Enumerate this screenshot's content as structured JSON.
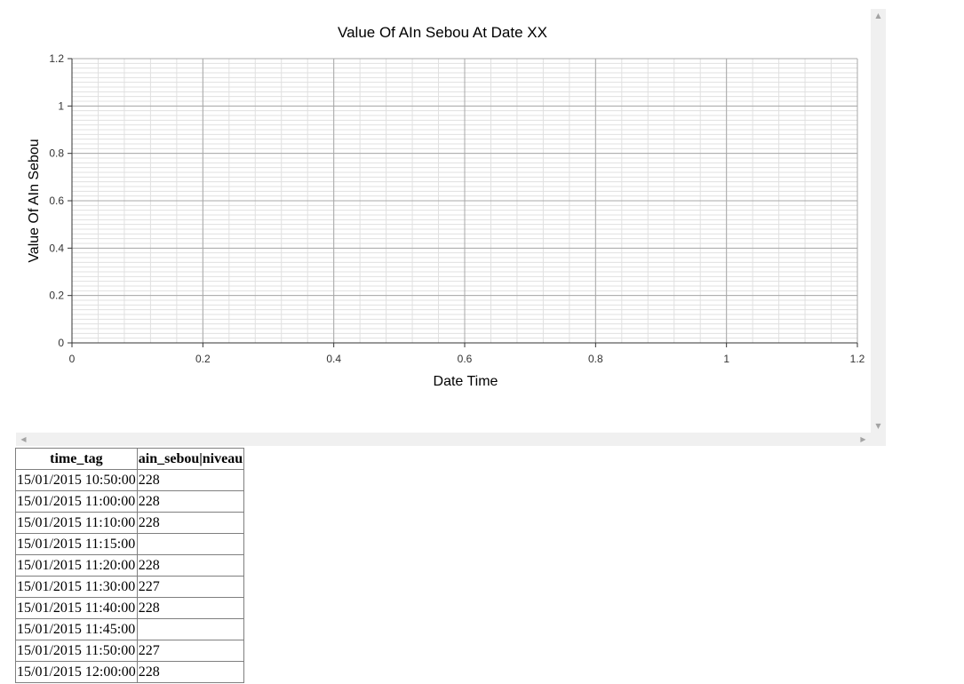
{
  "chart_data": {
    "type": "line",
    "title": "Value Of AIn Sebou At Date XX",
    "xlabel": "Date Time",
    "ylabel": "Value Of AIn Sebou",
    "xlim": [
      0,
      1.2
    ],
    "ylim": [
      0,
      1.2
    ],
    "xticks": [
      "0",
      "0.2",
      "0.4",
      "0.6",
      "0.8",
      "1",
      "1.2"
    ],
    "yticks": [
      "0",
      "0.2",
      "0.4",
      "0.6",
      "0.8",
      "1",
      "1.2"
    ],
    "grid": true,
    "series": []
  },
  "table": {
    "headers": [
      "time_tag",
      "ain_sebou|niveau"
    ],
    "rows": [
      [
        "15/01/2015 10:50:00",
        "228"
      ],
      [
        "15/01/2015 11:00:00",
        "228"
      ],
      [
        "15/01/2015 11:10:00",
        "228"
      ],
      [
        "15/01/2015 11:15:00",
        ""
      ],
      [
        "15/01/2015 11:20:00",
        "228"
      ],
      [
        "15/01/2015 11:30:00",
        "227"
      ],
      [
        "15/01/2015 11:40:00",
        "228"
      ],
      [
        "15/01/2015 11:45:00",
        ""
      ],
      [
        "15/01/2015 11:50:00",
        "227"
      ],
      [
        "15/01/2015 12:00:00",
        "228"
      ]
    ]
  },
  "scrollbars": {
    "up_icon": "arrow-up-icon",
    "down_icon": "arrow-down-icon",
    "left_icon": "arrow-left-icon",
    "right_icon": "arrow-right-icon"
  }
}
